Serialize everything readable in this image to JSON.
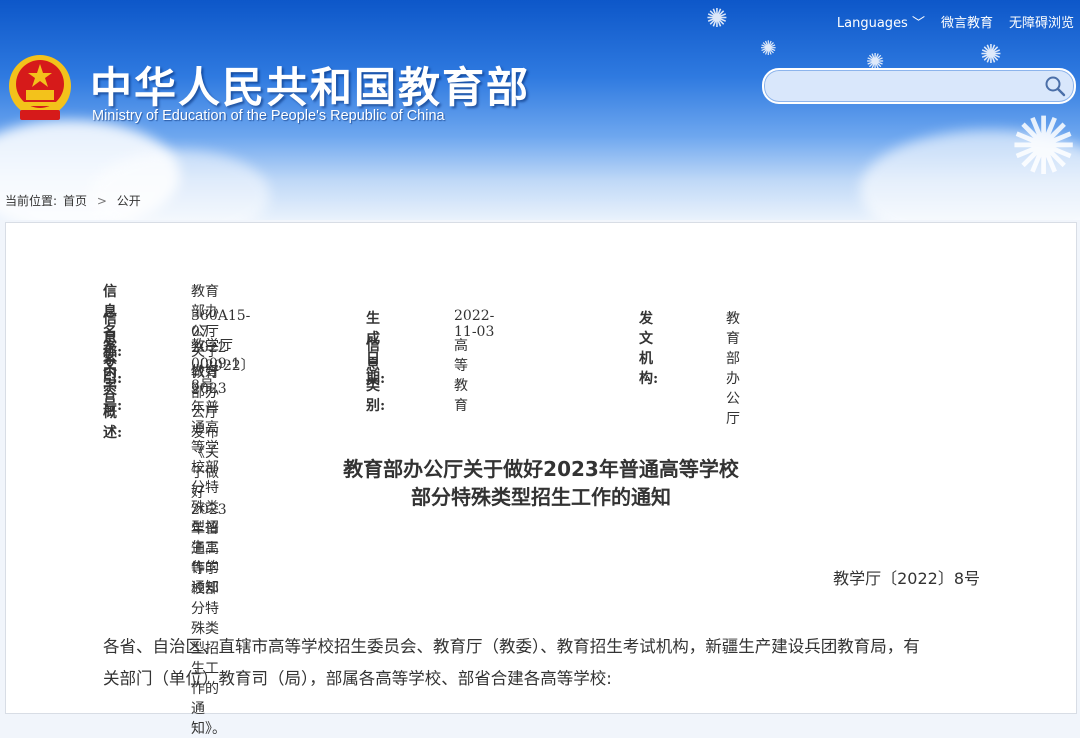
{
  "header": {
    "links": [
      "Languages ﹀",
      "微言教育",
      "无障碍浏览"
    ],
    "title_cn": "中华人民共和国教育部",
    "title_en": "Ministry of Education of the People's Republic of China",
    "search_placeholder": ""
  },
  "breadcrumb": {
    "label": "当前位置:",
    "home": "首页",
    "sep": ">",
    "current": "公开"
  },
  "meta": {
    "name_key": "信息名称:",
    "name_val": "教育部办公厅关于做好2023年普通高等学校部分特殊类型招生工作的通知",
    "index_key": "信息索引:",
    "index_val": "360A15-07-2022-0009-1",
    "date_key": "生成日期:",
    "date_val": "2022-11-03",
    "org_key": "发文机构:",
    "org_val": "教育部办公厅",
    "docno_key": "发文字号:",
    "docno_val": "教学厅〔2022〕8号",
    "cat_key": "信息类别:",
    "cat_val": "高等教育",
    "summary_key": "内容概述:",
    "summary_val": "教育部办公厅发布《关于做好2023年普通高等学校部分特殊类型招生工作的通知》。"
  },
  "doc": {
    "title_line1": "教育部办公厅关于做好2023年普通高等学校",
    "title_line2": "部分特殊类型招生工作的通知",
    "number": "教学厅〔2022〕8号",
    "body_line1": "各省、自治区、直辖市高等学校招生委员会、教育厅（教委）、教育招生考试机构，新疆生产建设兵团教育局，有",
    "body_line2": "关部门（单位）教育司（局），部属各高等学校、部省合建各高等学校:"
  },
  "colors": {
    "header_top": "#0d57c9",
    "emblem_red": "#d61a1a",
    "emblem_gold": "#f3c21b"
  }
}
